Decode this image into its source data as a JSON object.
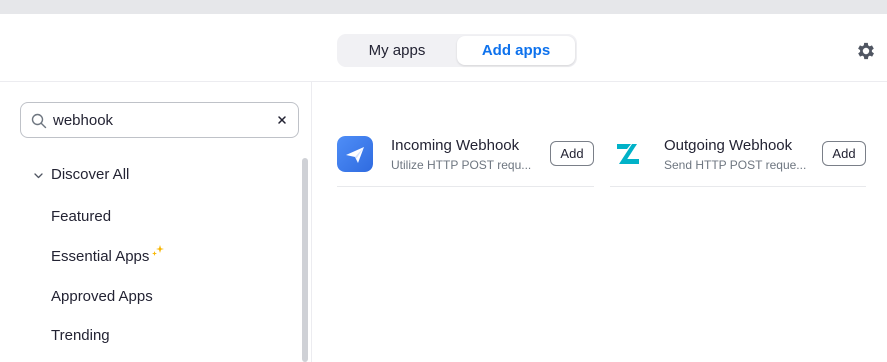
{
  "header": {
    "tabs": [
      {
        "label": "My apps",
        "active": false
      },
      {
        "label": "Add apps",
        "active": true
      }
    ],
    "settings_icon": "gear-icon"
  },
  "sidebar": {
    "search": {
      "value": "webhook",
      "placeholder": ""
    },
    "discover_all": {
      "label": "Discover All",
      "expanded": true
    },
    "items": [
      {
        "label": "Featured"
      },
      {
        "label": "Essential Apps",
        "icon": "sparkle-icon"
      },
      {
        "label": "Approved Apps"
      },
      {
        "label": "Trending"
      }
    ]
  },
  "apps": [
    {
      "name": "Incoming Webhook",
      "description": "Utilize HTTP POST requ...",
      "button": "Add",
      "icon": "paper-plane-icon"
    },
    {
      "name": "Outgoing Webhook",
      "description": "Send HTTP POST reque...",
      "button": "Add",
      "icon": "z-logo-icon"
    }
  ],
  "colors": {
    "accent": "#0e72ed",
    "text": "#232333",
    "muted": "#6e7680",
    "sparkle": "#f7b500",
    "outgoing_icon": "#00b2c8"
  }
}
